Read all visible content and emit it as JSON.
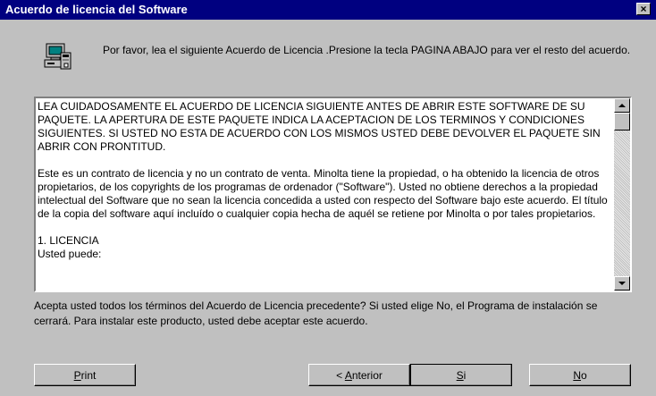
{
  "window": {
    "title": "Acuerdo de licencia del Software",
    "close_label": "×"
  },
  "header": {
    "icon": "install-computer-icon",
    "instruction": "Por favor, lea el siguiente Acuerdo de Licencia .Presione la tecla PAGINA ABAJO para ver el resto del acuerdo."
  },
  "license": {
    "paragraphs": [
      "LEA CUIDADOSAMENTE EL ACUERDO DE LICENCIA SIGUIENTE ANTES DE ABRIR ESTE SOFTWARE DE SU PAQUETE. LA APERTURA DE ESTE PAQUETE INDICA LA ACEPTACION DE LOS TERMINOS Y CONDICIONES SIGUIENTES. SI USTED NO ESTA DE ACUERDO CON LOS MISMOS USTED DEBE DEVOLVER EL PAQUETE SIN ABRIR CON PRONTITUD.",
      "Este es un contrato de licencia y no un contrato de venta. Minolta tiene la propiedad, o ha obtenido la licencia de otros propietarios, de los copyrights de los programas de ordenador (\"Software\"). Usted no obtiene derechos a la propiedad intelectual del Software que no sean la licencia concedida a usted con respecto del Software bajo este acuerdo. El título de la copia del software aquí incluído o cualquier copia hecha de aquél se retiene por Minolta o por tales propietarios.",
      "1. LICENCIA",
      "Usted puede:"
    ]
  },
  "question": "Acepta usted todos los términos del Acuerdo de Licencia precedente? Si usted elige No, el Programa de instalación se cerrará. Para instalar este producto, usted debe aceptar este acuerdo.",
  "buttons": {
    "print": {
      "label": "Print",
      "mnemonic": "P",
      "rest": "rint"
    },
    "back": {
      "label": "< Anterior",
      "prefix": "< ",
      "mnemonic": "A",
      "rest": "nterior"
    },
    "yes": {
      "label": "Si",
      "mnemonic": "S",
      "rest": "i"
    },
    "no": {
      "label": "No",
      "mnemonic": "N",
      "rest": "o"
    }
  },
  "colors": {
    "titlebar": "#000080",
    "face": "#c0c0c0"
  }
}
